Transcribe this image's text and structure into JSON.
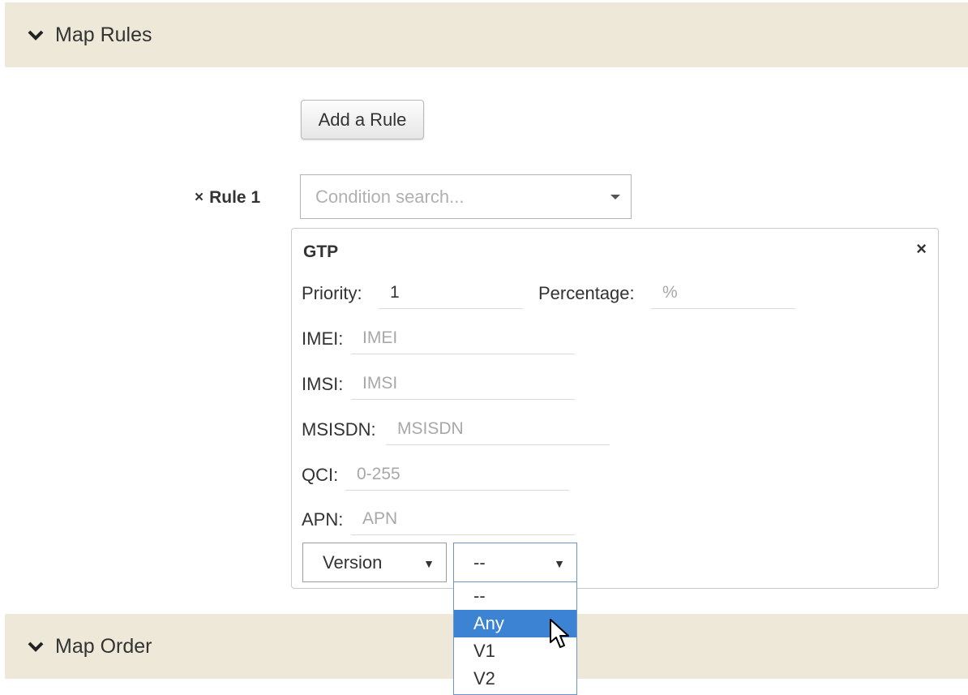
{
  "sections": {
    "map_rules": {
      "title": "Map Rules",
      "icon": "chevron-down-icon"
    },
    "map_order": {
      "title": "Map Order",
      "icon": "chevron-down-icon"
    }
  },
  "add_rule_button": "Add a Rule",
  "rule": {
    "remove_icon": "×",
    "label": "Rule 1",
    "condition_search": {
      "placeholder": "Condition search..."
    }
  },
  "gtp": {
    "title": "GTP",
    "close_icon": "×",
    "fields": {
      "priority": {
        "label": "Priority:",
        "value": "1",
        "placeholder": ""
      },
      "percentage": {
        "label": "Percentage:",
        "value": "",
        "placeholder": "%"
      },
      "imei": {
        "label": "IMEI:",
        "value": "",
        "placeholder": "IMEI"
      },
      "imsi": {
        "label": "IMSI:",
        "value": "",
        "placeholder": "IMSI"
      },
      "msisdn": {
        "label": "MSISDN:",
        "value": "",
        "placeholder": "MSISDN"
      },
      "qci": {
        "label": "QCI:",
        "value": "",
        "placeholder": "0-255"
      },
      "apn": {
        "label": "APN:",
        "value": "",
        "placeholder": "APN"
      }
    },
    "version_select": {
      "selected": "Version",
      "arrow": "▼"
    },
    "value_select": {
      "selected": "--",
      "arrow": "▼",
      "options": [
        "--",
        "Any",
        "V1",
        "V2"
      ],
      "highlighted": "Any"
    }
  },
  "colors": {
    "section_bg": "#ede8d8",
    "highlight": "#3d83d3",
    "focus_border": "#6b95c8"
  }
}
